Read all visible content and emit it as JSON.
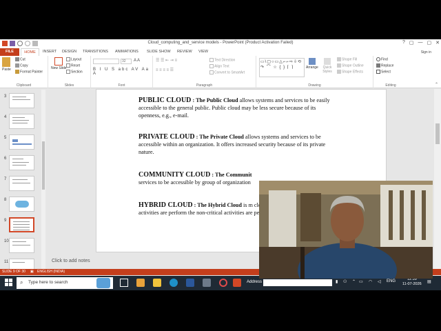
{
  "window": {
    "title": "Cloud_computing_and_service models - PowerPoint (Product Activation Failed)",
    "controls": [
      "?",
      "▢",
      "—",
      "▢",
      "✕"
    ]
  },
  "menu": {
    "file": "FILE",
    "tabs": [
      "HOME",
      "INSERT",
      "DESIGN",
      "TRANSITIONS",
      "ANIMATIONS",
      "SLIDE SHOW",
      "REVIEW",
      "VIEW"
    ],
    "signin": "Sign in"
  },
  "ribbon": {
    "clipboard": {
      "label": "Clipboard",
      "paste": "Paste",
      "cut": "Cut",
      "copy": "Copy",
      "format_painter": "Format Painter"
    },
    "slides": {
      "label": "Slides",
      "new_slide": "New Slide",
      "layout": "Layout",
      "reset": "Reset",
      "section": "Section"
    },
    "font": {
      "label": "Font",
      "font_size": "32",
      "buttons": "B I U S abc AV Aa A"
    },
    "paragraph": {
      "label": "Paragraph",
      "text_direction": "Text Direction",
      "align_text": "Align Text",
      "smartart": "Convert to SmartArt"
    },
    "drawing": {
      "label": "Drawing",
      "arrange": "Arrange",
      "quick_styles": "Quick Styles",
      "shape_fill": "Shape Fill",
      "shape_outline": "Shape Outline",
      "shape_effects": "Shape Effects",
      "shapes_glyphs": "▭\\▢○▭△⌐⌐⇨⇩⟲ ↷ ⌒ ☆ { } ⌈ ⌉"
    },
    "editing": {
      "label": "Editing",
      "find": "Find",
      "replace": "Replace",
      "select": "Select"
    }
  },
  "thumbnails": [
    {
      "num": "3"
    },
    {
      "num": "4"
    },
    {
      "num": "5"
    },
    {
      "num": "6"
    },
    {
      "num": "7"
    },
    {
      "num": "8"
    },
    {
      "num": "9"
    },
    {
      "num": "10"
    },
    {
      "num": "11"
    }
  ],
  "slide": {
    "paragraphs": [
      {
        "head": "PUBLIC CLOUD",
        "sep": " : The ",
        "term": "Public Cloud",
        "rest": " allows systems and services to be easily accessible to the general public. Public cloud may be less secure because of its openness, e.g., e-mail."
      },
      {
        "head": "PRIVATE CLOUD",
        "sep": " : The ",
        "term": "Private Cloud",
        "rest": " allows systems and services to be accessible within an organization. It offers increased security because of its private nature."
      },
      {
        "head": "COMMUNITY CLOUD",
        "sep": " : The ",
        "term": "Communit",
        "rest": "services to be accessible by group of organization"
      },
      {
        "head": "HYBRID CLOUD",
        "sep": " : The ",
        "term": "Hybrid Cloud",
        "rest": " is m cloud. However, the critical activities are perform the non-critical activities are performed using pub"
      }
    ]
  },
  "notes": "Click to add notes",
  "status": {
    "slide": "SLIDE 9 OF 30",
    "lang": "ENGLISH (INDIA)"
  },
  "taskbar": {
    "search_placeholder": "Type here to search",
    "address_label": "Address",
    "lang": "ENG",
    "time": "12:39",
    "date": "11-07-2026"
  }
}
